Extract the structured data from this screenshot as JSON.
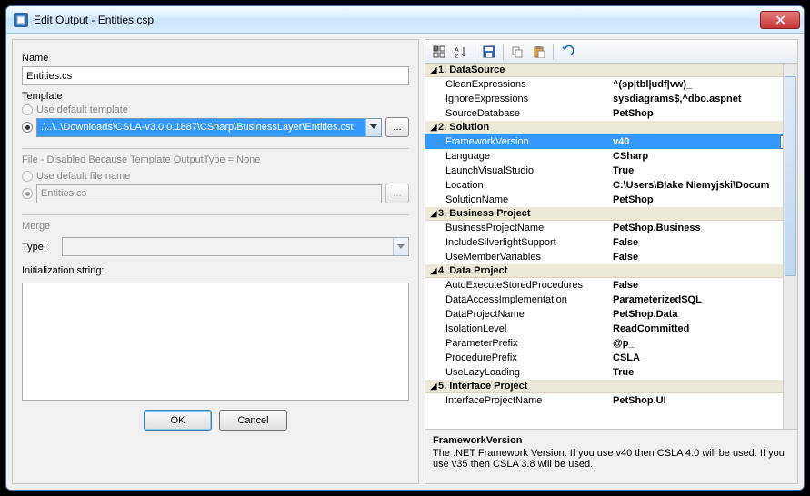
{
  "window": {
    "title": "Edit Output - Entities.csp"
  },
  "left": {
    "name_label": "Name",
    "name_value": "Entities.cs",
    "template_label": "Template",
    "template_default_label": "Use default template",
    "template_path": ".\\..\\..\\Downloads\\CSLA-v3.0.0.1887\\CSharp\\BusinessLayer\\Entities.cst",
    "browse": "...",
    "file_group": "File - Disabled Because Template OutputType = None",
    "file_default_label": "Use default file name",
    "file_value": "Entities.cs",
    "merge_label": "Merge",
    "type_label": "Type:",
    "init_label": "Initialization string:",
    "ok": "OK",
    "cancel": "Cancel"
  },
  "desc": {
    "title": "FrameworkVersion",
    "body": "The .NET Framework Version. If you use v40 then CSLA 4.0 will be used. If you use v35 then CSLA 3.8 will be used."
  },
  "grid": [
    {
      "header": "1. DataSource",
      "rows": [
        {
          "n": "CleanExpressions",
          "v": "^(sp|tbl|udf|vw)_"
        },
        {
          "n": "IgnoreExpressions",
          "v": "sysdiagrams$,^dbo.aspnet"
        },
        {
          "n": "SourceDatabase",
          "v": "PetShop"
        }
      ]
    },
    {
      "header": "2. Solution",
      "rows": [
        {
          "n": "FrameworkVersion",
          "v": "v40",
          "selected": true,
          "dd": true
        },
        {
          "n": "Language",
          "v": "CSharp"
        },
        {
          "n": "LaunchVisualStudio",
          "v": "True"
        },
        {
          "n": "Location",
          "v": "C:\\Users\\Blake Niemyjski\\Docum"
        },
        {
          "n": "SolutionName",
          "v": "PetShop"
        }
      ]
    },
    {
      "header": "3. Business Project",
      "rows": [
        {
          "n": "BusinessProjectName",
          "v": "PetShop.Business"
        },
        {
          "n": "IncludeSilverlightSupport",
          "v": "False"
        },
        {
          "n": "UseMemberVariables",
          "v": "False"
        }
      ]
    },
    {
      "header": "4. Data Project",
      "rows": [
        {
          "n": "AutoExecuteStoredProcedures",
          "v": "False"
        },
        {
          "n": "DataAccessImplementation",
          "v": "ParameterizedSQL"
        },
        {
          "n": "DataProjectName",
          "v": "PetShop.Data"
        },
        {
          "n": "IsolationLevel",
          "v": "ReadCommitted"
        },
        {
          "n": "ParameterPrefix",
          "v": "@p_"
        },
        {
          "n": "ProcedurePrefix",
          "v": "CSLA_"
        },
        {
          "n": "UseLazyLoading",
          "v": "True"
        }
      ]
    },
    {
      "header": "5. Interface Project",
      "rows": [
        {
          "n": "InterfaceProjectName",
          "v": "PetShop.UI"
        }
      ]
    }
  ]
}
